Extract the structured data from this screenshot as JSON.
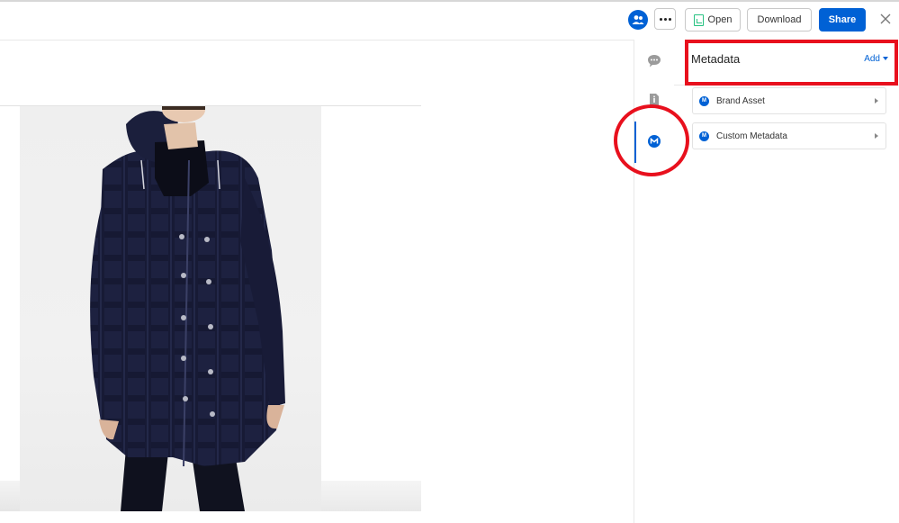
{
  "toolbar": {
    "collaborators_icon": "people-icon",
    "more_icon": "ellipsis-icon",
    "open_label": "Open",
    "open_icon": "file-image-icon",
    "download_label": "Download",
    "share_label": "Share",
    "close_icon": "close-icon"
  },
  "preview": {
    "image_subject": "model-wearing-navy-plaid-hooded-jacket"
  },
  "sidebar_nav": {
    "items": [
      {
        "icon": "comment-icon",
        "active": false
      },
      {
        "icon": "info-icon",
        "active": false
      },
      {
        "icon": "metadata-icon",
        "active": true
      }
    ],
    "accent": "#0061d5"
  },
  "panel": {
    "title": "Metadata",
    "add_label": "Add",
    "cards": [
      {
        "badge": "M",
        "label": "Brand Asset"
      },
      {
        "badge": "M",
        "label": "Custom Metadata"
      }
    ]
  },
  "annotations": {
    "color": "#e8101d"
  }
}
